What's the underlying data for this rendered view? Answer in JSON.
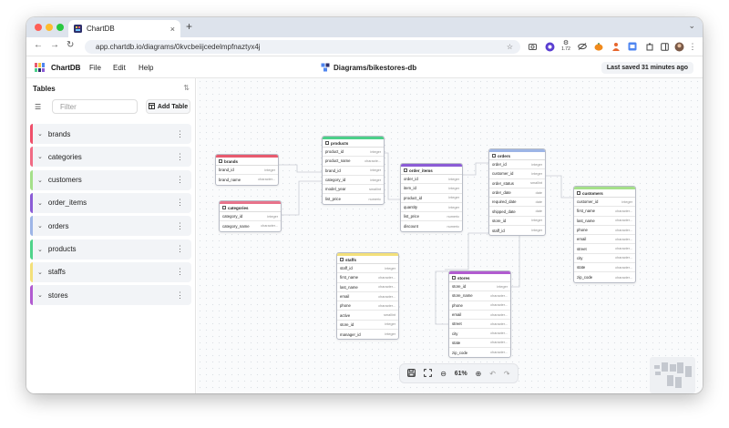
{
  "browser": {
    "tab_title": "ChartDB",
    "tab_close": "×",
    "new_tab": "+",
    "tabs_dropdown": "⌄",
    "url": "app.chartdb.io/diagrams/0kvcbeiijcedelmpfnaztyx4j",
    "nav": {
      "back": "←",
      "forward": "→",
      "reload": "↻"
    },
    "bookmark_star": "☆",
    "ext_badge": "1.72",
    "extensions": [
      "camera-icon",
      "shield-icon",
      "badge-icon",
      "eye-off-icon",
      "pumpkin-icon",
      "person-icon",
      "translate-icon",
      "puzzle-icon",
      "square-icon",
      "avatar",
      "kebab-menu-icon"
    ],
    "colors": {
      "close": "#ff5f57",
      "minimize": "#febc2e",
      "maximize": "#28c840"
    }
  },
  "app": {
    "name": "ChartDB",
    "menu": [
      "File",
      "Edit",
      "Help"
    ],
    "diagram_name": "Diagrams/bikestores-db",
    "last_saved": "Last saved 31 minutes ago"
  },
  "sidebar": {
    "title": "Tables",
    "sort_icon": "⇅",
    "list_icon": "☰",
    "filter_placeholder": "Filter",
    "add_table_label": "Add Table",
    "items": [
      {
        "label": "brands",
        "color": "#ef4f6a"
      },
      {
        "label": "categories",
        "color": "#f06b84"
      },
      {
        "label": "customers",
        "color": "#a5e08a"
      },
      {
        "label": "order_items",
        "color": "#8b5cd6"
      },
      {
        "label": "orders",
        "color": "#9db5e6"
      },
      {
        "label": "products",
        "color": "#4fd38a"
      },
      {
        "label": "staffs",
        "color": "#f3e07a"
      },
      {
        "label": "stores",
        "color": "#b15bd0"
      }
    ]
  },
  "tables": {
    "brands": {
      "name": "brands",
      "color": "#e85a6e",
      "fields": [
        [
          "brand_id",
          "integer"
        ],
        [
          "brand_name",
          "character..."
        ]
      ]
    },
    "categories": {
      "name": "categories",
      "color": "#e8738b",
      "fields": [
        [
          "category_id",
          "integer"
        ],
        [
          "category_name",
          "character..."
        ]
      ]
    },
    "products": {
      "name": "products",
      "color": "#4cd08a",
      "fields": [
        [
          "product_id",
          "integer"
        ],
        [
          "product_name",
          "characte..."
        ],
        [
          "brand_id",
          "integer"
        ],
        [
          "category_id",
          "integer"
        ],
        [
          "model_year",
          "smallint"
        ],
        [
          "list_price",
          "numeric"
        ]
      ]
    },
    "order_items": {
      "name": "order_items",
      "color": "#8b5cd6",
      "fields": [
        [
          "order_id",
          "integer"
        ],
        [
          "item_id",
          "integer"
        ],
        [
          "product_id",
          "integer"
        ],
        [
          "quantity",
          "integer"
        ],
        [
          "list_price",
          "numeric"
        ],
        [
          "discount",
          "numeric"
        ]
      ]
    },
    "orders": {
      "name": "orders",
      "color": "#9db5e6",
      "fields": [
        [
          "order_id",
          "integer"
        ],
        [
          "customer_id",
          "integer"
        ],
        [
          "order_status",
          "smallint"
        ],
        [
          "order_date",
          "date"
        ],
        [
          "required_date",
          "date"
        ],
        [
          "shipped_date",
          "date"
        ],
        [
          "store_id",
          "integer"
        ],
        [
          "staff_id",
          "integer"
        ]
      ]
    },
    "customers": {
      "name": "customers",
      "color": "#a5e08a",
      "fields": [
        [
          "customer_id",
          "integer"
        ],
        [
          "first_name",
          "character..."
        ],
        [
          "last_name",
          "character..."
        ],
        [
          "phone",
          "character..."
        ],
        [
          "email",
          "character..."
        ],
        [
          "street",
          "character..."
        ],
        [
          "city",
          "character..."
        ],
        [
          "state",
          "character..."
        ],
        [
          "zip_code",
          "character..."
        ]
      ]
    },
    "staffs": {
      "name": "staffs",
      "color": "#f3e07a",
      "fields": [
        [
          "staff_id",
          "integer"
        ],
        [
          "first_name",
          "character..."
        ],
        [
          "last_name",
          "character..."
        ],
        [
          "email",
          "character..."
        ],
        [
          "phone",
          "character..."
        ],
        [
          "active",
          "smallint"
        ],
        [
          "store_id",
          "integer"
        ],
        [
          "manager_id",
          "integer"
        ]
      ]
    },
    "stores": {
      "name": "stores",
      "color": "#b15bd0",
      "fields": [
        [
          "store_id",
          "integer"
        ],
        [
          "store_name",
          "character..."
        ],
        [
          "phone",
          "character..."
        ],
        [
          "email",
          "character..."
        ],
        [
          "street",
          "character..."
        ],
        [
          "city",
          "character..."
        ],
        [
          "state",
          "character..."
        ],
        [
          "zip_code",
          "character..."
        ]
      ]
    }
  },
  "toolbar": {
    "save": "💾",
    "fit": "⛶",
    "zoom_out": "⊖",
    "zoom": "61%",
    "zoom_in": "⊕",
    "undo": "↶",
    "redo": "↷"
  }
}
